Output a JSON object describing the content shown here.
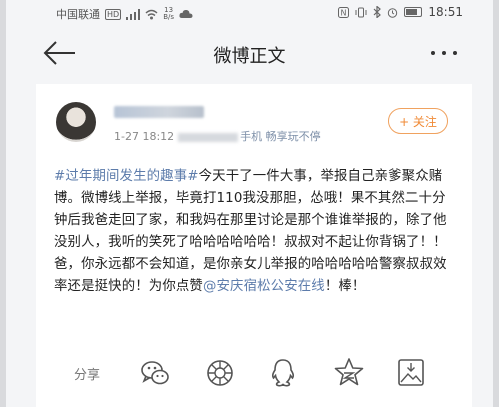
{
  "status_bar": {
    "carrier": "中国联通",
    "hd": "HD",
    "net_speed_value": "13",
    "net_speed_unit": "B/s",
    "time": "18:51"
  },
  "nav": {
    "title": "微博正文"
  },
  "post": {
    "meta_time": "1-27 18:12",
    "meta_device": "手机 畅享玩不停",
    "follow_label": "+ 关注",
    "topic": "#过年期间发生的趣事#",
    "body_main": "今天干了一件大事，举报自己亲爹聚众赌博。微博线上举报，毕竟打110我没那胆，怂哦！果不其然二十分钟后我爸走回了家，和我妈在那里讨论是那个谁谁举报的，除了他没别人，我听的笑死了哈哈哈哈哈哈！叔叔对不起让你背锅了！！爸，你永远都不会知道，是你亲女儿举报的哈哈哈哈哈警察叔叔效率还是挺快的！为你点赞",
    "mention": "@安庆宿松公安在线",
    "body_end": "！棒！"
  },
  "share": {
    "label": "分享",
    "targets": [
      "wechat-icon",
      "moments-icon",
      "qq-icon",
      "qzone-icon",
      "save-image-icon"
    ]
  }
}
